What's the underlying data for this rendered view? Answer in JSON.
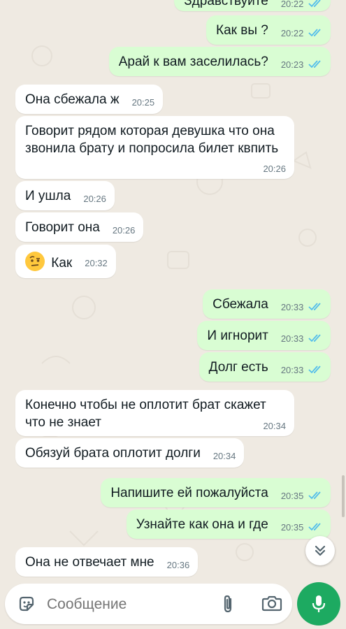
{
  "messages": [
    {
      "dir": "out",
      "text": "Здравствуйте",
      "time": "20:22",
      "read": true
    },
    {
      "dir": "out",
      "text": "Как вы ?",
      "time": "20:22",
      "read": true
    },
    {
      "dir": "out",
      "text": "Арай к вам заселилась?",
      "time": "20:23",
      "read": true
    },
    {
      "dir": "in",
      "text": "Она сбежала ж",
      "time": "20:25"
    },
    {
      "dir": "in",
      "text": "Говорит рядом которая девушка что она звонила брату и попросила билет квпить",
      "time": "20:26"
    },
    {
      "dir": "in",
      "text": "И ушла",
      "time": "20:26"
    },
    {
      "dir": "in",
      "text": "Говорит она",
      "time": "20:26"
    },
    {
      "dir": "in",
      "text": "Как",
      "time": "20:32",
      "emoji": "raised-eyebrow-face"
    },
    {
      "dir": "out",
      "text": "Сбежала",
      "time": "20:33",
      "read": true
    },
    {
      "dir": "out",
      "text": "И игнорит",
      "time": "20:33",
      "read": true
    },
    {
      "dir": "out",
      "text": "Долг есть",
      "time": "20:33",
      "read": true
    },
    {
      "dir": "in",
      "text": "Конечно чтобы не оплотит брат скажет что не знает",
      "time": "20:34"
    },
    {
      "dir": "in",
      "text": "Обязуй брата оплотит долги",
      "time": "20:34"
    },
    {
      "dir": "out",
      "text": "Напишите ей пожалуйста",
      "time": "20:35",
      "read": true
    },
    {
      "dir": "out",
      "text": "Узнайте как она и где",
      "time": "20:35",
      "read": true
    },
    {
      "dir": "in",
      "text": "Она не отвечает мне",
      "time": "20:36"
    }
  ],
  "composer": {
    "placeholder": "Сообщение",
    "icons": [
      "sticker-icon",
      "paperclip-icon",
      "camera-icon",
      "microphone-icon"
    ]
  },
  "scroll_button": {
    "icon": "double-chevron-down-icon"
  },
  "colors": {
    "background": "#efeae2",
    "incoming_bubble": "#ffffff",
    "outgoing_bubble": "#d9fdd3",
    "read_ticks": "#53bdeb",
    "send_button": "#1daa61"
  }
}
